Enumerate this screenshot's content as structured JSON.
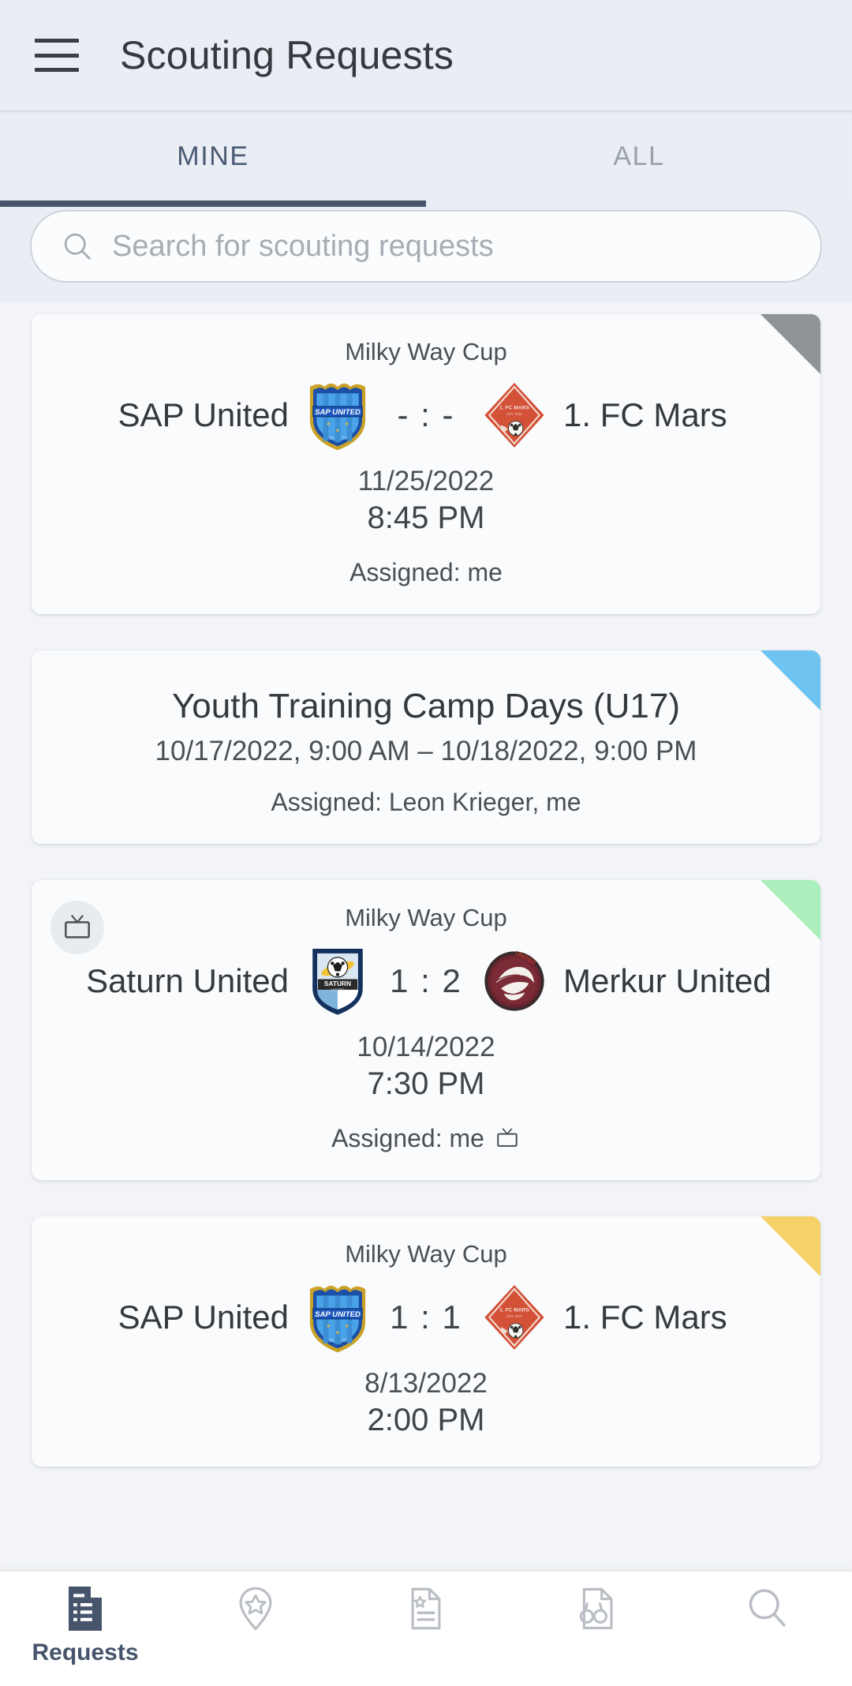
{
  "header": {
    "title": "Scouting Requests",
    "menu_icon": "hamburger-menu-icon"
  },
  "tabs": {
    "items": [
      {
        "label": "MINE",
        "active": true
      },
      {
        "label": "ALL",
        "active": false
      }
    ]
  },
  "search": {
    "placeholder": "Search for scouting requests",
    "value": "",
    "icon": "search-icon"
  },
  "colors": {
    "accent": "#46556c",
    "header_bg": "#e9edf4",
    "content_bg": "#f2f4f7",
    "card_bg": "#fafbfc",
    "corner_gray": "#909398",
    "corner_blue": "#6fc3f0",
    "corner_green": "#abefbd",
    "corner_yellow": "#f5d168"
  },
  "cards": [
    {
      "type": "match",
      "corner_color": "gray",
      "has_tv_badge": false,
      "competition": "Milky Way Cup",
      "home_team": "SAP United",
      "home_crest": "sap-united-crest",
      "score": "- : -",
      "away_crest": "fc-mars-crest",
      "away_team": "1. FC Mars",
      "date": "11/25/2022",
      "time": "8:45 PM",
      "assigned": "Assigned: me",
      "assigned_tv": false
    },
    {
      "type": "event",
      "corner_color": "blue",
      "has_tv_badge": false,
      "title": "Youth Training Camp Days (U17)",
      "range": "10/17/2022, 9:00 AM – 10/18/2022, 9:00 PM",
      "assigned": "Assigned: Leon Krieger, me",
      "assigned_tv": false
    },
    {
      "type": "match",
      "corner_color": "green",
      "has_tv_badge": true,
      "competition": "Milky Way Cup",
      "home_team": "Saturn United",
      "home_crest": "saturn-united-crest",
      "score": "1 : 2",
      "away_crest": "merkur-united-crest",
      "away_team": "Merkur United",
      "date": "10/14/2022",
      "time": "7:30 PM",
      "assigned": "Assigned: me",
      "assigned_tv": true
    },
    {
      "type": "match",
      "corner_color": "yellow",
      "has_tv_badge": false,
      "competition": "Milky Way Cup",
      "home_team": "SAP United",
      "home_crest": "sap-united-crest",
      "score": "1 : 1",
      "away_crest": "fc-mars-crest",
      "away_team": "1. FC Mars",
      "date": "8/13/2022",
      "time": "2:00 PM",
      "assigned": "",
      "assigned_tv": false
    }
  ],
  "bottom_nav": {
    "items": [
      {
        "label": "Requests",
        "icon": "requests-document-icon",
        "active": true
      },
      {
        "label": "",
        "icon": "map-pin-star-icon",
        "active": false
      },
      {
        "label": "",
        "icon": "document-star-icon",
        "active": false
      },
      {
        "label": "",
        "icon": "document-binoculars-icon",
        "active": false
      },
      {
        "label": "",
        "icon": "search-magnifier-icon",
        "active": false
      }
    ]
  }
}
